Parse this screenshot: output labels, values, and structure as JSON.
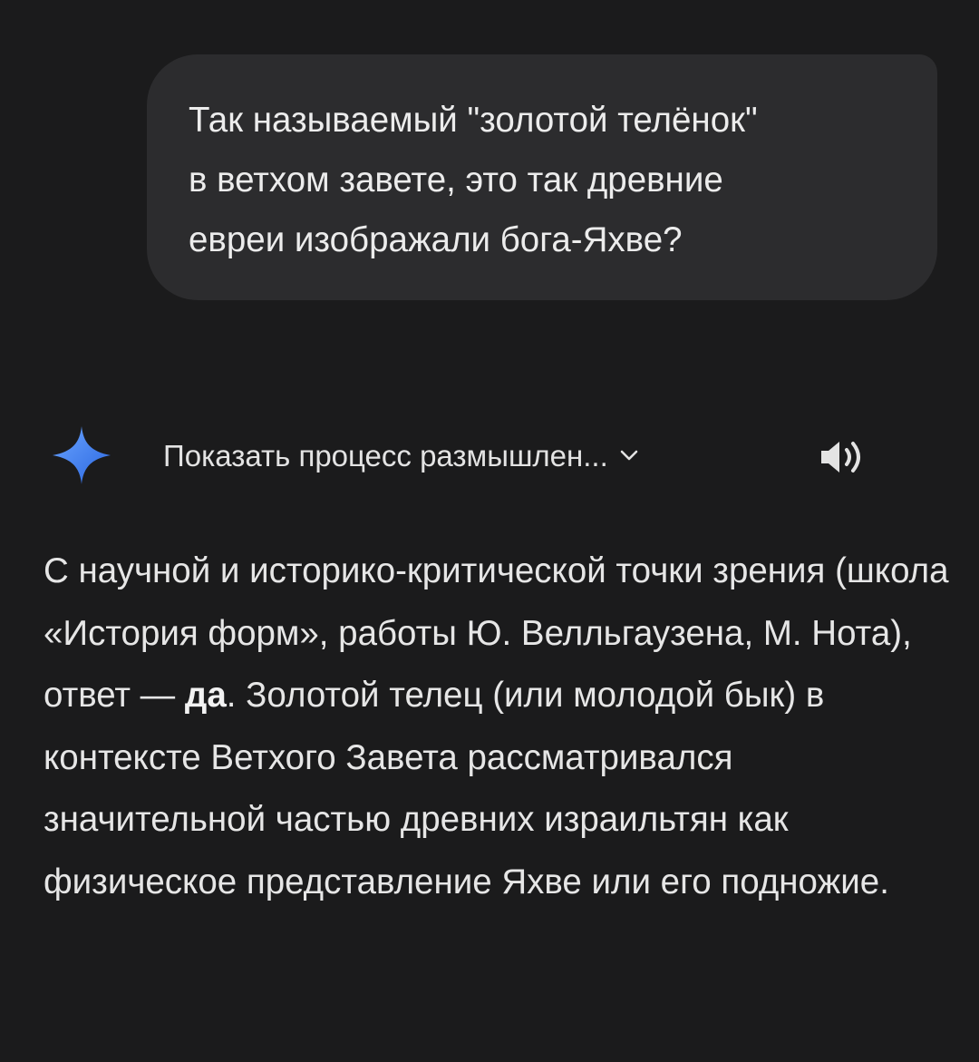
{
  "user_message": {
    "text": "Так называемый \"золотой телёнок\"\nв ветхом завете, это так древние\nевреи изображали бога-Яхве?"
  },
  "response_header": {
    "icon": "gemini-sparkle-icon",
    "thinking_toggle_label": "Показать процесс размышлен...",
    "chevron_icon": "chevron-down-icon",
    "speaker_icon": "speaker-icon"
  },
  "response": {
    "part1": "С научной и историко-критической точки зрения (школа «История форм», работы Ю. Велльгаузена, М. Нота), ответ — ",
    "bold": "да",
    "part2": ". Золотой телец (или молодой бык) в контексте Ветхого Завета рассматривался значительной частью древних израильтян как физическое представление Яхве или его подножие."
  },
  "colors": {
    "background": "#1b1b1c",
    "bubble": "#2c2c2e",
    "text": "#e6e6e6",
    "gemini_gradient": [
      "#4f8df7",
      "#2f6fe6"
    ]
  }
}
